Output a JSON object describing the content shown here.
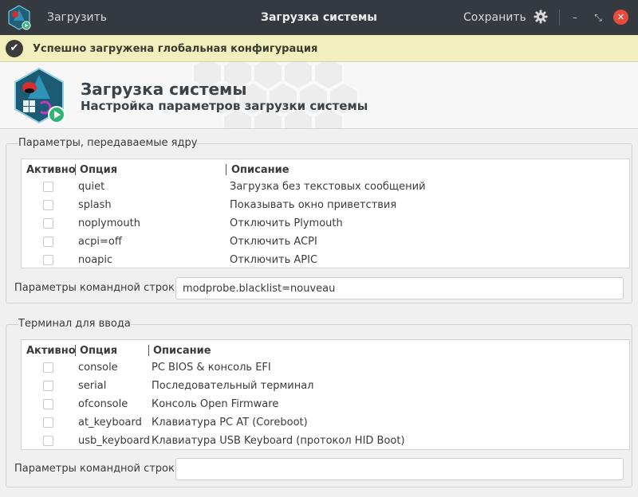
{
  "titlebar": {
    "load_label": "Загрузить",
    "title": "Загрузка системы",
    "save_label": "Сохранить",
    "icons": [
      "app-icon",
      "gear-icon",
      "minimize-icon",
      "restore-icon",
      "close-icon"
    ]
  },
  "notification": {
    "message": "Успешно загружена глобальная конфигурация"
  },
  "header": {
    "title": "Загрузка системы",
    "subtitle": "Настройка параметров загрузки системы"
  },
  "kernel": {
    "group_title": "Параметры, передаваемые ядру",
    "columns": [
      "Активно",
      "Опция",
      "Описание"
    ],
    "rows": [
      {
        "option": "quiet",
        "description": "Загрузка без текстовых сообщений",
        "active": false
      },
      {
        "option": "splash",
        "description": "Показывать окно приветствия",
        "active": false
      },
      {
        "option": "noplymouth",
        "description": "Отключить Plymouth",
        "active": false
      },
      {
        "option": "acpi=off",
        "description": "Отключить ACPI",
        "active": false
      },
      {
        "option": "noapic",
        "description": "Отключить APIC",
        "active": false
      }
    ],
    "cmdline_label": "Параметры командной строки:",
    "cmdline_value": "modprobe.blacklist=nouveau"
  },
  "terminal": {
    "group_title": "Терминал для ввода",
    "columns": [
      "Активно",
      "Опция",
      "Описание"
    ],
    "rows": [
      {
        "option": "console",
        "description": "PC BIOS & консоль EFI",
        "active": false
      },
      {
        "option": "serial",
        "description": "Последовательный терминал",
        "active": false
      },
      {
        "option": "ofconsole",
        "description": "Консоль Open Firmware",
        "active": false
      },
      {
        "option": "at_keyboard",
        "description": "Клавиатура PC AT (Coreboot)",
        "active": false
      },
      {
        "option": "usb_keyboard",
        "description": "Клавиатура USB Keyboard (протокол HID Boot)",
        "active": false
      }
    ],
    "cmdline_label": "Параметры командной строки:",
    "cmdline_value": ""
  },
  "colors": {
    "titlebar_bg": "#353a40",
    "notify_bg": "#f2efbe",
    "close_button": "#e74c3c"
  }
}
